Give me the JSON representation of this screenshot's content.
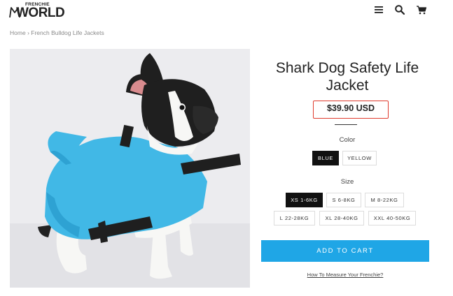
{
  "brand": {
    "small": "FRENCHIE",
    "big": "WORLD"
  },
  "header": {
    "icons": [
      "menu-icon",
      "search-icon",
      "cart-icon"
    ]
  },
  "breadcrumb": {
    "home": "Home",
    "separator": "›",
    "current": "French Bulldog Life Jackets"
  },
  "product": {
    "title": "Shark Dog Safety Life Jacket",
    "price": "$39.90 USD",
    "color": {
      "label": "Color",
      "options": [
        "BLUE",
        "YELLOW"
      ],
      "selected": "BLUE"
    },
    "size": {
      "label": "Size",
      "options": [
        "XS 1-6KG",
        "S 6-8KG",
        "M 8-22KG",
        "L 22-28KG",
        "XL 28-40KG",
        "XXL 40-50KG"
      ],
      "selected": "XS 1-6KG"
    },
    "add_to_cart": "ADD TO CART",
    "measure_link": "How To Measure Your Frenchie?"
  },
  "colors": {
    "accent": "#1fa6e6",
    "highlight_box": "#e03b2e",
    "selected_swatch": "#111111"
  }
}
